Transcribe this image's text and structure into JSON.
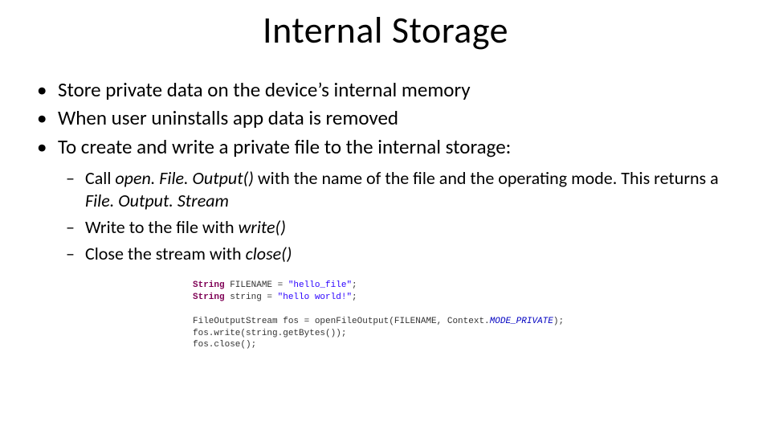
{
  "title": "Internal Storage",
  "bullets": {
    "b1": "Store private data on the device’s internal memory",
    "b2": "When user uninstalls app data is removed",
    "b3": "To create and write a private file to the internal storage:"
  },
  "sub": {
    "s1_a": "Call ",
    "s1_b": "open. File. Output()",
    "s1_c": " with the name of the file and the operating mode. This returns a ",
    "s1_d": "File. Output. Stream",
    "s2_a": "Write to the file with ",
    "s2_b": "write()",
    "s3_a": "Close the stream with ",
    "s3_b": "close()"
  },
  "code": {
    "kw_string": "String",
    "id_filename": " FILENAME = ",
    "str_hello_file": "\"hello_file\"",
    "semi": ";",
    "id_string": " string = ",
    "str_hello_world": "\"hello world!\"",
    "fos_decl1": "FileOutputStream fos = openFileOutput(FILENAME, Context.",
    "mode_private": "MODE_PRIVATE",
    "fos_decl2": ");",
    "fos_write": "fos.write(string.getBytes());",
    "fos_close": "fos.close();"
  }
}
